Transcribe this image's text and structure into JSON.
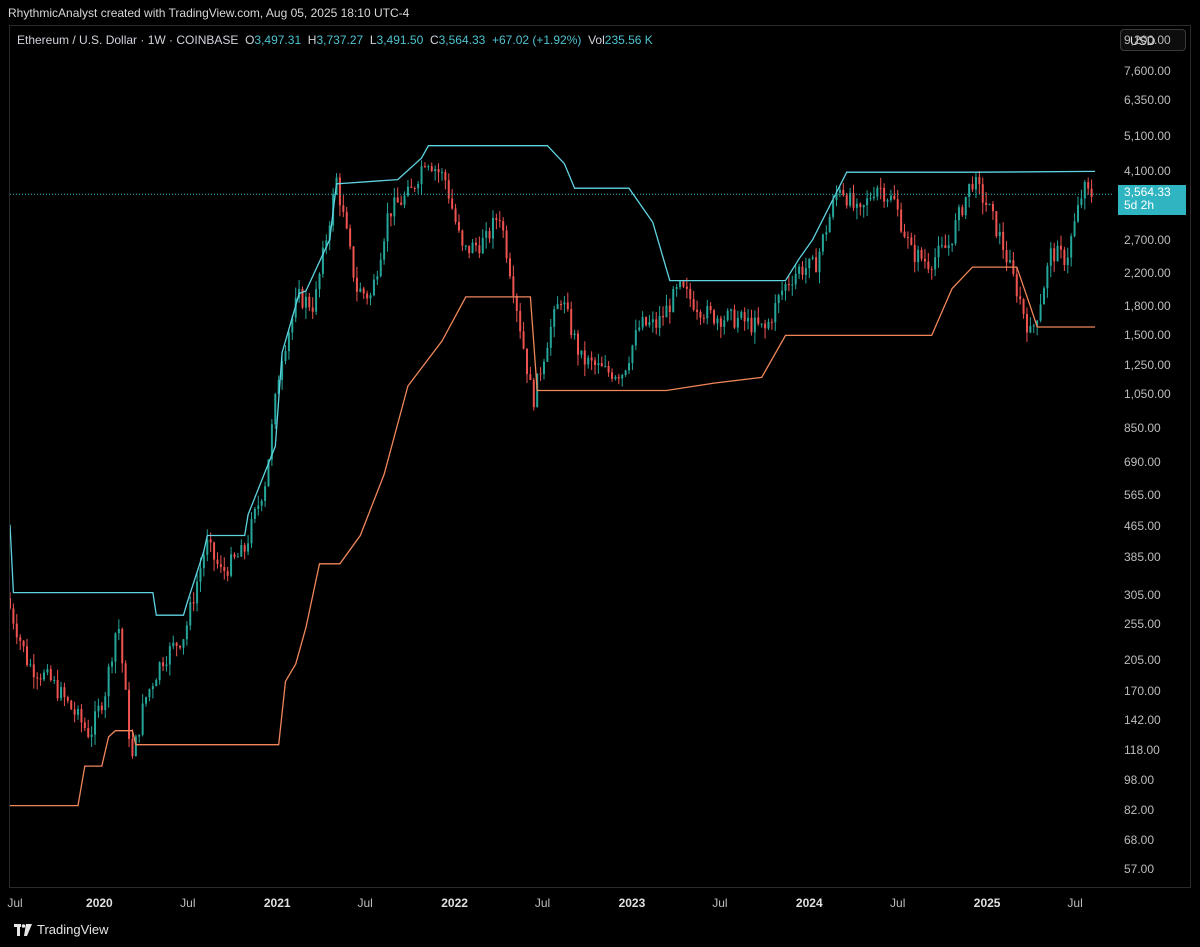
{
  "header": {
    "caption": "RhythmicAnalyst created with TradingView.com, Aug 05, 2025 18:10 UTC-4"
  },
  "legend": {
    "symbol": "Ethereum / U.S. Dollar · 1W · COINBASE",
    "open_key": "O",
    "open": "3,497.31",
    "high_key": "H",
    "high": "3,737.27",
    "low_key": "L",
    "low": "3,491.50",
    "close_key": "C",
    "close": "3,564.33",
    "change": "+67.02 (+1.92%)",
    "vol_key": "Vol",
    "vol": "235.56 K"
  },
  "currency": "USD",
  "price_tag": {
    "price": "3,564.33",
    "countdown": "5d 2h"
  },
  "footer": {
    "brand": "TradingView",
    "logo_icon": "tradingview-logo-icon"
  },
  "colors": {
    "upper": "#5fd3e0",
    "lower": "#f0865a",
    "up": "#26a69a",
    "down": "#ef5350"
  },
  "chart_data": {
    "type": "candlestick",
    "title": "Ethereum / U.S. Dollar · 1W · COINBASE",
    "y_scale": "log",
    "ylim": [
      51,
      10000
    ],
    "y_ticks": [
      "9,200.00",
      "7,600.00",
      "6,350.00",
      "5,100.00",
      "4,100.00",
      "2,700.00",
      "2,200.00",
      "1,800.00",
      "1,500.00",
      "1,250.00",
      "1,050.00",
      "850.00",
      "690.00",
      "565.00",
      "465.00",
      "385.00",
      "305.00",
      "255.00",
      "205.00",
      "170.00",
      "142.00",
      "118.00",
      "98.00",
      "82.00",
      "68.00",
      "57.00"
    ],
    "x_ticks": [
      {
        "label": "Jul",
        "date": "2019-07-01",
        "year": false
      },
      {
        "label": "2020",
        "date": "2020-01-01",
        "year": true
      },
      {
        "label": "Jul",
        "date": "2020-07-01",
        "year": false
      },
      {
        "label": "2021",
        "date": "2021-01-01",
        "year": true
      },
      {
        "label": "Jul",
        "date": "2021-07-01",
        "year": false
      },
      {
        "label": "2022",
        "date": "2022-01-01",
        "year": true
      },
      {
        "label": "Jul",
        "date": "2022-07-01",
        "year": false
      },
      {
        "label": "2023",
        "date": "2023-01-01",
        "year": true
      },
      {
        "label": "Jul",
        "date": "2023-07-01",
        "year": false
      },
      {
        "label": "2024",
        "date": "2024-01-01",
        "year": true
      },
      {
        "label": "Jul",
        "date": "2024-07-01",
        "year": false
      },
      {
        "label": "2025",
        "date": "2025-01-01",
        "year": true
      },
      {
        "label": "Jul",
        "date": "2025-07-01",
        "year": false
      }
    ],
    "x_range": [
      "2019-07-01",
      "2025-09-15"
    ],
    "last_price": 3564.33,
    "price_path": [
      [
        "2019-07-01",
        300
      ],
      [
        "2019-08-15",
        200
      ],
      [
        "2019-10-01",
        180
      ],
      [
        "2019-11-15",
        150
      ],
      [
        "2019-12-20",
        130
      ],
      [
        "2020-01-20",
        170
      ],
      [
        "2020-02-15",
        265
      ],
      [
        "2020-03-15",
        110
      ],
      [
        "2020-04-10",
        160
      ],
      [
        "2020-05-15",
        205
      ],
      [
        "2020-07-01",
        240
      ],
      [
        "2020-08-15",
        420
      ],
      [
        "2020-09-15",
        350
      ],
      [
        "2020-11-01",
        400
      ],
      [
        "2020-12-15",
        620
      ],
      [
        "2021-01-15",
        1300
      ],
      [
        "2021-02-20",
        1900
      ],
      [
        "2021-03-25",
        1800
      ],
      [
        "2021-05-10",
        3900
      ],
      [
        "2021-06-20",
        2000
      ],
      [
        "2021-07-20",
        1900
      ],
      [
        "2021-08-25",
        3200
      ],
      [
        "2021-10-10",
        3600
      ],
      [
        "2021-11-10",
        4500
      ],
      [
        "2021-12-20",
        3900
      ],
      [
        "2022-01-25",
        2500
      ],
      [
        "2022-03-15",
        2700
      ],
      [
        "2022-04-10",
        3200
      ],
      [
        "2022-05-10",
        2000
      ],
      [
        "2022-06-18",
        1000
      ],
      [
        "2022-07-20",
        1500
      ],
      [
        "2022-08-15",
        1900
      ],
      [
        "2022-09-25",
        1300
      ],
      [
        "2022-11-15",
        1200
      ],
      [
        "2022-12-20",
        1200
      ],
      [
        "2023-01-25",
        1600
      ],
      [
        "2023-03-01",
        1600
      ],
      [
        "2023-04-15",
        2000
      ],
      [
        "2023-06-15",
        1700
      ],
      [
        "2023-08-20",
        1650
      ],
      [
        "2023-10-10",
        1550
      ],
      [
        "2023-11-15",
        2000
      ],
      [
        "2023-12-15",
        2250
      ],
      [
        "2024-01-20",
        2300
      ],
      [
        "2024-03-10",
        3800
      ],
      [
        "2024-04-20",
        3100
      ],
      [
        "2024-05-25",
        3800
      ],
      [
        "2024-07-01",
        3400
      ],
      [
        "2024-08-05",
        2500
      ],
      [
        "2024-09-10",
        2350
      ],
      [
        "2024-10-20",
        2600
      ],
      [
        "2024-12-08",
        3900
      ],
      [
        "2025-01-10",
        3300
      ],
      [
        "2025-02-05",
        2700
      ],
      [
        "2025-03-15",
        1900
      ],
      [
        "2025-04-08",
        1500
      ],
      [
        "2025-04-25",
        1800
      ],
      [
        "2025-05-20",
        2500
      ],
      [
        "2025-06-20",
        2400
      ],
      [
        "2025-07-25",
        3700
      ],
      [
        "2025-08-05",
        3564
      ]
    ],
    "series": [
      {
        "name": "upper",
        "values": [
          [
            "2019-07-01",
            470
          ],
          [
            "2019-07-08",
            310
          ],
          [
            "2020-04-20",
            310
          ],
          [
            "2020-04-27",
            270
          ],
          [
            "2020-06-22",
            270
          ],
          [
            "2020-06-29",
            290
          ],
          [
            "2020-08-03",
            400
          ],
          [
            "2020-08-10",
            440
          ],
          [
            "2020-10-26",
            440
          ],
          [
            "2020-11-02",
            500
          ],
          [
            "2020-12-28",
            760
          ],
          [
            "2021-01-11",
            1350
          ],
          [
            "2021-02-08",
            1800
          ],
          [
            "2021-02-15",
            1940
          ],
          [
            "2021-03-01",
            1970
          ],
          [
            "2021-04-19",
            2700
          ],
          [
            "2021-05-03",
            3800
          ],
          [
            "2021-09-06",
            3900
          ],
          [
            "2021-10-25",
            4450
          ],
          [
            "2021-11-08",
            4800
          ],
          [
            "2022-07-11",
            4800
          ],
          [
            "2022-08-15",
            4300
          ],
          [
            "2022-09-05",
            3700
          ],
          [
            "2022-12-26",
            3700
          ],
          [
            "2023-02-13",
            3000
          ],
          [
            "2023-03-20",
            2100
          ],
          [
            "2023-11-13",
            2100
          ],
          [
            "2023-12-11",
            2400
          ],
          [
            "2024-01-08",
            2700
          ],
          [
            "2024-03-18",
            4080
          ],
          [
            "2024-12-09",
            4080
          ],
          [
            "2025-08-11",
            4100
          ]
        ]
      },
      {
        "name": "lower",
        "values": [
          [
            "2019-07-01",
            84
          ],
          [
            "2019-11-18",
            84
          ],
          [
            "2019-12-02",
            107
          ],
          [
            "2020-01-06",
            107
          ],
          [
            "2020-01-20",
            128
          ],
          [
            "2020-02-03",
            133
          ],
          [
            "2020-03-09",
            133
          ],
          [
            "2020-03-16",
            122
          ],
          [
            "2021-01-04",
            122
          ],
          [
            "2021-01-18",
            180
          ],
          [
            "2021-02-08",
            200
          ],
          [
            "2021-03-01",
            250
          ],
          [
            "2021-03-29",
            370
          ],
          [
            "2021-05-10",
            370
          ],
          [
            "2021-06-21",
            440
          ],
          [
            "2021-08-09",
            640
          ],
          [
            "2021-09-27",
            1100
          ],
          [
            "2021-12-06",
            1450
          ],
          [
            "2022-01-24",
            1900
          ],
          [
            "2022-06-06",
            1900
          ],
          [
            "2022-06-20",
            1070
          ],
          [
            "2023-03-13",
            1070
          ],
          [
            "2023-06-19",
            1120
          ],
          [
            "2023-09-25",
            1160
          ],
          [
            "2023-11-13",
            1500
          ],
          [
            "2024-09-09",
            1500
          ],
          [
            "2024-10-21",
            2000
          ],
          [
            "2024-12-02",
            2280
          ],
          [
            "2025-03-03",
            2280
          ],
          [
            "2025-03-31",
            1790
          ],
          [
            "2025-04-14",
            1580
          ],
          [
            "2025-08-11",
            1580
          ]
        ]
      }
    ]
  }
}
